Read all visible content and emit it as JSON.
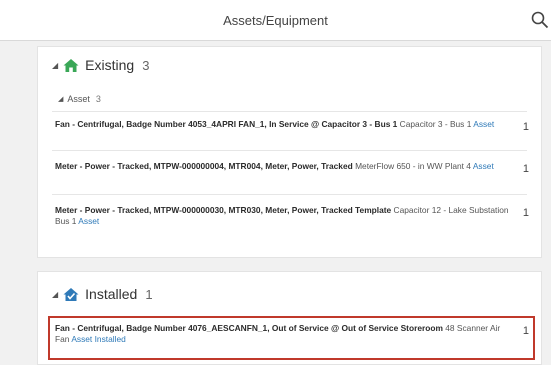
{
  "header": {
    "title": "Assets/Equipment"
  },
  "existing": {
    "label": "Existing",
    "count": "3",
    "sub_label": "Asset",
    "sub_count": "3",
    "items": [
      {
        "title": "Fan - Centrifugal, Badge Number 4053_4APRI FAN_1, In Service @ Capacitor 3 - Bus 1",
        "detail": "Capacitor 3 - Bus 1",
        "link": "Asset",
        "qty": "1"
      },
      {
        "title": "Meter - Power - Tracked, MTPW-000000004, MTR004, Meter, Power, Tracked",
        "detail": "MeterFlow 650 - in WW Plant 4",
        "link": "Asset",
        "qty": "1"
      },
      {
        "title": "Meter - Power - Tracked, MTPW-000000030, MTR030, Meter, Power, Tracked Template",
        "detail": "Capacitor 12 - Lake Substation Bus 1",
        "link": "Asset",
        "qty": "1"
      }
    ]
  },
  "installed": {
    "label": "Installed",
    "count": "1",
    "items": [
      {
        "title": "Fan - Centrifugal, Badge Number 4076_AESCANFN_1, Out of Service @ Out of Service Storeroom",
        "detail": "48 Scanner Air Fan",
        "link": "Asset Installed",
        "qty": "1"
      }
    ]
  },
  "colors": {
    "accent_green": "#3aa757",
    "accent_blue": "#2f7ab8",
    "highlight_red": "#c0392b"
  },
  "icons": {
    "search": "search-icon",
    "existing": "home-icon",
    "installed": "installed-home-icon"
  }
}
